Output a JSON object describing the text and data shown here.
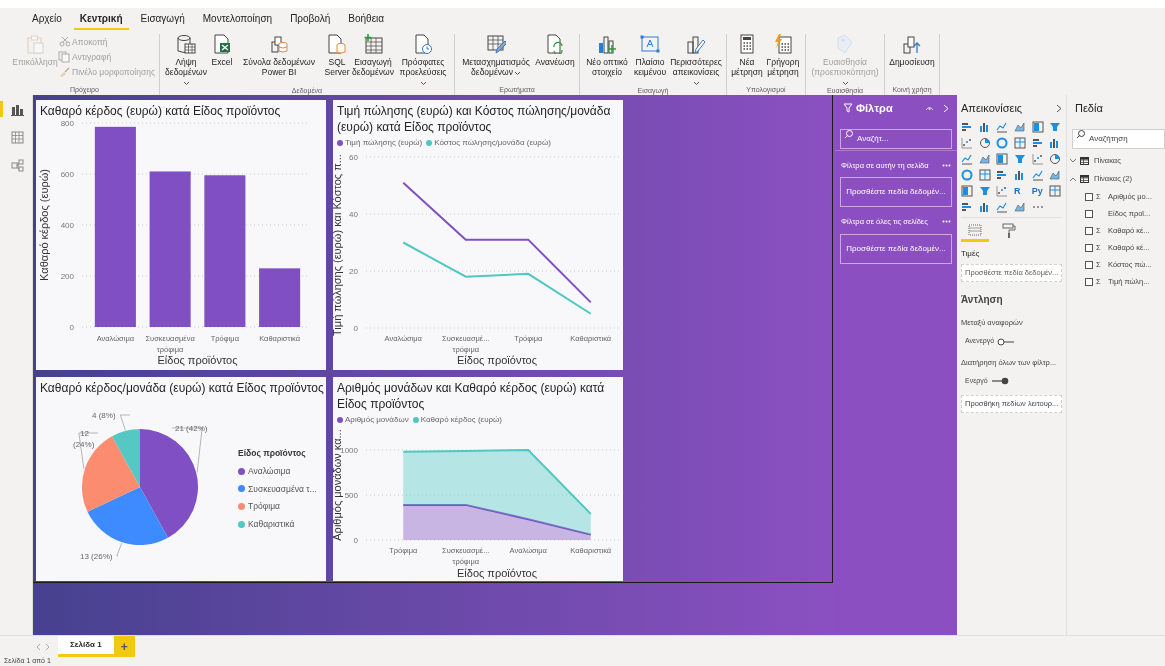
{
  "ribbon": {
    "tabs": [
      {
        "label": "Αρχείο",
        "selected": false
      },
      {
        "label": "Κεντρική",
        "selected": true
      },
      {
        "label": "Εισαγωγή",
        "selected": false
      },
      {
        "label": "Μοντελοποίηση",
        "selected": false
      },
      {
        "label": "Προβολή",
        "selected": false
      },
      {
        "label": "Βοήθεια",
        "selected": false
      }
    ],
    "groups": [
      {
        "label": "Πρόχειρο",
        "buttons": [
          {
            "kind": "large",
            "label": "Επικόλληση",
            "disabled": true,
            "dropdown": false
          },
          {
            "kind": "small",
            "label": "Αποκοπή",
            "disabled": true,
            "dropdown": false
          },
          {
            "kind": "small",
            "label": "Αντιγραφή",
            "disabled": true,
            "dropdown": false
          },
          {
            "kind": "small",
            "label": "Πινέλο μορφοποίησης",
            "disabled": true,
            "dropdown": false
          }
        ]
      },
      {
        "label": "Δεδομένα",
        "buttons": [
          {
            "kind": "large",
            "label": "Λήψη δεδομένων",
            "disabled": false,
            "dropdown": true
          },
          {
            "kind": "large",
            "label": "Excel",
            "disabled": false,
            "dropdown": false
          },
          {
            "kind": "large",
            "label": "Σύνολα δεδομένων Power BI",
            "disabled": false,
            "dropdown": false
          },
          {
            "kind": "large",
            "label": "SQL Server",
            "disabled": false,
            "dropdown": false
          },
          {
            "kind": "large",
            "label": "Εισαγωγή δεδομένων",
            "disabled": false,
            "dropdown": false
          },
          {
            "kind": "large",
            "label": "Πρόσφατες προελεύσεις",
            "disabled": false,
            "dropdown": true
          }
        ]
      },
      {
        "label": "Ερωτήματα",
        "buttons": [
          {
            "kind": "large",
            "label": "Μετασχηματισμός δεδομένων",
            "disabled": false,
            "dropdown": true
          },
          {
            "kind": "large",
            "label": "Ανανέωση",
            "disabled": false,
            "dropdown": false
          }
        ]
      },
      {
        "label": "Εισαγωγή",
        "buttons": [
          {
            "kind": "large",
            "label": "Νέο οπτικό στοιχείο",
            "disabled": false,
            "dropdown": false
          },
          {
            "kind": "large",
            "label": "Πλαίσιο κειμένου",
            "disabled": false,
            "dropdown": false
          },
          {
            "kind": "large",
            "label": "Περισσότερες απεικονίσεις",
            "disabled": false,
            "dropdown": true
          }
        ]
      },
      {
        "label": "Υπολογισμοί",
        "buttons": [
          {
            "kind": "large",
            "label": "Νέα μέτρηση",
            "disabled": false,
            "dropdown": false
          },
          {
            "kind": "large",
            "label": "Γρήγορη μέτρηση",
            "disabled": false,
            "dropdown": false
          }
        ]
      },
      {
        "label": "Ευαισθησία",
        "buttons": [
          {
            "kind": "large",
            "label": "Ευαισθησία (προεπισκόπηση)",
            "disabled": true,
            "dropdown": true
          }
        ]
      },
      {
        "label": "Κοινή χρήση",
        "buttons": [
          {
            "kind": "large",
            "label": "Δημοσίευση",
            "disabled": false,
            "dropdown": false
          }
        ]
      }
    ]
  },
  "view_switcher": [
    {
      "selected": true
    },
    {
      "selected": false
    },
    {
      "selected": false
    }
  ],
  "visuals": [
    {
      "chart_data": {
        "type": "bar",
        "title": "Καθαρό κέρδος (ευρώ) κατά Είδος προϊόντος",
        "xlabel": "Είδος προϊόντος",
        "ylabel": "Καθαρό κέρδος (ευρώ)",
        "categories": [
          "Αναλώσιμα",
          "Συσκευασμένα τρόφιμα",
          "Τρόφιμα",
          "Καθαριστικά"
        ],
        "series": [
          {
            "color": "#7f4fc3",
            "values": [
              785,
              610,
              595,
              230
            ]
          }
        ],
        "yticks": [
          0,
          200,
          400,
          600,
          800
        ],
        "ylim": [
          0,
          800
        ],
        "grid": true
      }
    },
    {
      "chart_data": {
        "type": "line",
        "title": "Τιμή πώλησης (ευρώ) και Κόστος πώλησης/μονάδα (ευρώ) κατά Είδος προϊόντος",
        "xlabel": "Είδος προϊόντος",
        "ylabel": "Τιμή πώλησης (ευρώ) και Κόστος π...",
        "categories": [
          "Αναλώσιμα",
          "Συσκευασμέ... τρόφιμα",
          "Τρόφιμα",
          "Καθαριστικά"
        ],
        "series": [
          {
            "name": "Τιμή πώλησης (ευρώ)",
            "color": "#7f4fc3",
            "values": [
              51,
              31,
              31,
              9
            ]
          },
          {
            "name": "Κόστος πώλησης/μονάδα (ευρώ)",
            "color": "#4fc8c3",
            "values": [
              30,
              18,
              19,
              5
            ]
          }
        ],
        "yticks": [
          0,
          20,
          40,
          60
        ],
        "ylim": [
          0,
          60
        ],
        "grid": true,
        "legend": true
      }
    },
    {
      "chart_data": {
        "type": "pie",
        "title": "Καθαρό κέρδος/μονάδα (ευρώ) κατά Είδος προϊόντος",
        "legend_title": "Είδος προϊόντος",
        "categories": [
          "Αναλώσιμα",
          "Συσκευασμένα τ...",
          "Τρόφιμα",
          "Καθαριστικά"
        ],
        "values": [
          21,
          13,
          12,
          4
        ],
        "colors": [
          "#7f4fc3",
          "#3d8bff",
          "#fb8c6f",
          "#55c8c4"
        ],
        "value_labels": [
          "21 (42%)",
          "13 (26%)",
          "12 (24%)",
          "4 (8%)"
        ],
        "legend": true
      }
    },
    {
      "chart_data": {
        "type": "area",
        "stacked": true,
        "title": "Αριθμός μονάδων και Καθαρό κέρδος (ευρώ) κατά Είδος προϊόντος",
        "xlabel": "Είδος προϊόντος",
        "ylabel": "Αριθμός μονάδων κα...",
        "categories": [
          "Τρόφιμα",
          "Συσκευασμέ... τρόφιμα",
          "Αναλώσιμα",
          "Καθαριστικά"
        ],
        "series": [
          {
            "name": "Αριθμός μονάδων",
            "color": "#7f4fc3",
            "values": [
              390,
              390,
              230,
              60
            ]
          },
          {
            "name": "Καθαρό κέρδος (ευρώ)",
            "color": "#4fc8c3",
            "values": [
              590,
              600,
              770,
              230
            ]
          }
        ],
        "yticks": [
          0,
          500,
          1000
        ],
        "ylim": [
          0,
          1000
        ],
        "grid": true,
        "legend": true
      }
    }
  ],
  "filters_pane": {
    "title": "Φίλτρα",
    "search": {
      "placeholder": "Αναζήτ..."
    },
    "sections": [
      {
        "title": "Φίλτρα σε αυτήν τη σελίδα",
        "drop_zone": "Προσθέστε πεδία δεδομέν..."
      },
      {
        "title": "Φίλτρα σε όλες τις σελίδες",
        "drop_zone": "Προσθέστε πεδία δεδομέν..."
      }
    ]
  },
  "visualizations_pane": {
    "title": "Απεικονίσεις",
    "gallery": [
      {
        "kind": "icon"
      },
      {
        "kind": "icon"
      },
      {
        "kind": "icon"
      },
      {
        "kind": "icon"
      },
      {
        "kind": "icon"
      },
      {
        "kind": "icon"
      },
      {
        "kind": "icon"
      },
      {
        "kind": "icon"
      },
      {
        "kind": "icon"
      },
      {
        "kind": "icon"
      },
      {
        "kind": "icon"
      },
      {
        "kind": "icon"
      },
      {
        "kind": "icon"
      },
      {
        "kind": "icon"
      },
      {
        "kind": "icon"
      },
      {
        "kind": "icon"
      },
      {
        "kind": "icon"
      },
      {
        "kind": "icon"
      },
      {
        "kind": "icon"
      },
      {
        "kind": "icon"
      },
      {
        "kind": "icon"
      },
      {
        "kind": "icon"
      },
      {
        "kind": "icon"
      },
      {
        "kind": "icon"
      },
      {
        "kind": "icon"
      },
      {
        "kind": "icon"
      },
      {
        "kind": "icon"
      },
      {
        "kind": "text",
        "label": "R"
      },
      {
        "kind": "text",
        "label": "Py"
      },
      {
        "kind": "icon"
      },
      {
        "kind": "icon"
      },
      {
        "kind": "icon"
      },
      {
        "kind": "icon"
      },
      {
        "kind": "icon"
      },
      {
        "kind": "more"
      }
    ],
    "build_tabs": [
      {
        "selected": true
      },
      {
        "selected": false
      }
    ],
    "values_label": "Τιμές",
    "values_zone": "Προσθέστε πεδία δεδομέν...",
    "drillthrough": {
      "title": "Άντληση",
      "toggles": [
        {
          "label": "Μεταξύ αναφορών",
          "state_text": "Ανενεργό",
          "on": false
        },
        {
          "label": "Διατήρηση όλων των φίλτρ...",
          "state_text": "Ενεργό",
          "on": true
        }
      ],
      "drop_zone": "Προσθήκη πεδίων λειτουρ..."
    }
  },
  "fields_pane": {
    "title": "Πεδία",
    "search": {
      "placeholder": "Αναζήτηση"
    },
    "tables": [
      {
        "name": "Πίνακας",
        "expanded": false
      },
      {
        "name": "Πίνακας (2)",
        "expanded": true,
        "children": [
          {
            "name": "Αριθμός μο...",
            "aggregate": "Σ",
            "checked": false
          },
          {
            "name": "Είδος προϊ...",
            "checked": false
          },
          {
            "name": "Καθαρό κέ...",
            "aggregate": "Σ",
            "checked": false
          },
          {
            "name": "Καθαρό κέ...",
            "aggregate": "Σ",
            "checked": false
          },
          {
            "name": "Κόστος πώ...",
            "aggregate": "Σ",
            "checked": false
          },
          {
            "name": "Τιμή πώλη...",
            "aggregate": "Σ",
            "checked": false
          }
        ]
      }
    ]
  },
  "page_tabs": [
    {
      "label": "Σελίδα 1",
      "selected": true
    }
  ],
  "add_page": "+",
  "status_bar": "Σελίδα 1 από 1"
}
